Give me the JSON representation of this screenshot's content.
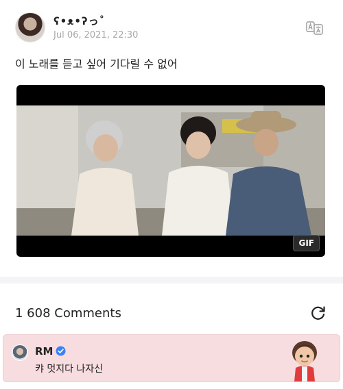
{
  "post": {
    "author": "ʕ•ᴥ•ʔっ˚",
    "timestamp": "Jul 06, 2021, 22:30",
    "text": "이 노래를 듣고 싶어 기다릴 수 없어",
    "media_badge": "GIF",
    "icons": {
      "avatar": "user-avatar",
      "translate": "translate-icon"
    }
  },
  "comments": {
    "count_label": "1 608 Comments",
    "refresh_icon": "refresh-icon",
    "items": [
      {
        "author": "RM",
        "verified": true,
        "text": "캬 멋지다 나자신"
      }
    ]
  },
  "colors": {
    "comment_highlight": "#f7dde0",
    "verified_blue": "#3b82f6",
    "timestamp_gray": "#a7a7a7"
  }
}
